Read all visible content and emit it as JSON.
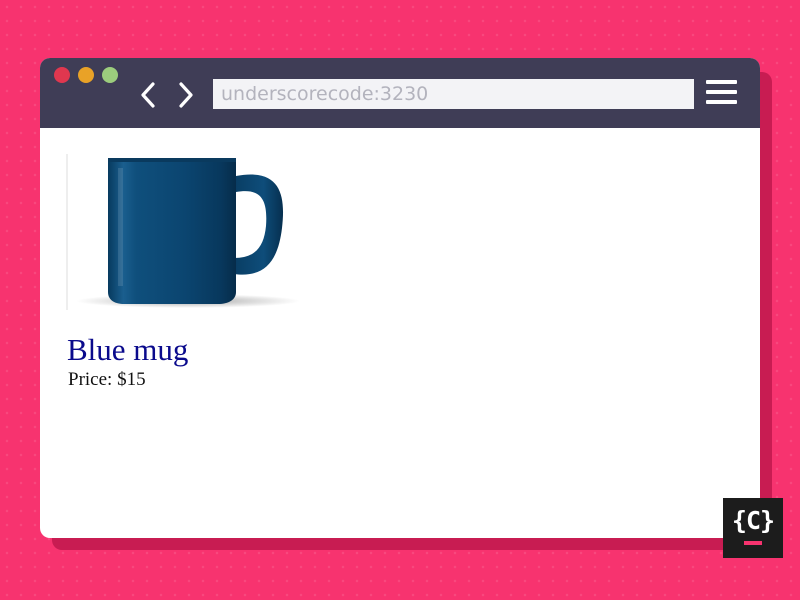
{
  "browser": {
    "address": "underscorecode:3230",
    "controls": {
      "close_color": "#e0374f",
      "minimize_color": "#e9a227",
      "maximize_color": "#9ccd7d"
    },
    "icons": {
      "back": "chevron-left-icon",
      "forward": "chevron-right-icon",
      "menu": "hamburger-menu-icon"
    }
  },
  "product": {
    "image_icon": "blue-mug",
    "title": "Blue mug",
    "price": "Price: $15"
  },
  "logo": {
    "text": "{C}",
    "accent_color": "#f7336f"
  }
}
